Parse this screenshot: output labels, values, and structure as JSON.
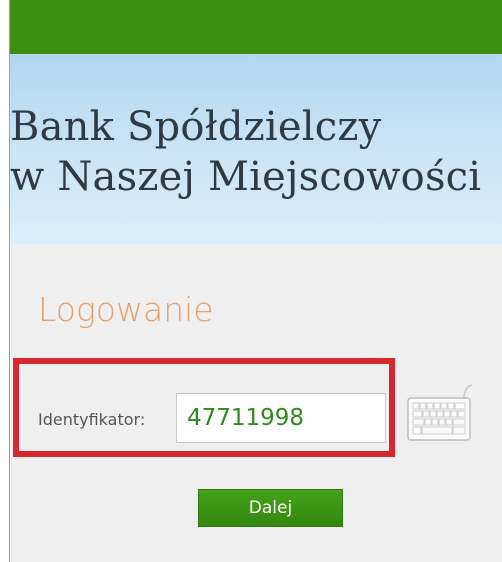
{
  "header": {
    "line1": "Bank Spółdzielczy",
    "line2": "w Naszej Miejscowości"
  },
  "login": {
    "title": "Logowanie",
    "id_label": "Identyfikator:",
    "id_value": "47711998",
    "next_label": "Dalej",
    "keyboard_icon": "virtual-keyboard-icon"
  },
  "colors": {
    "brand_green": "#3a8f12",
    "title_orange": "#e8a06e",
    "input_text_green": "#2e8c1c",
    "highlight_red": "#d8262e"
  }
}
